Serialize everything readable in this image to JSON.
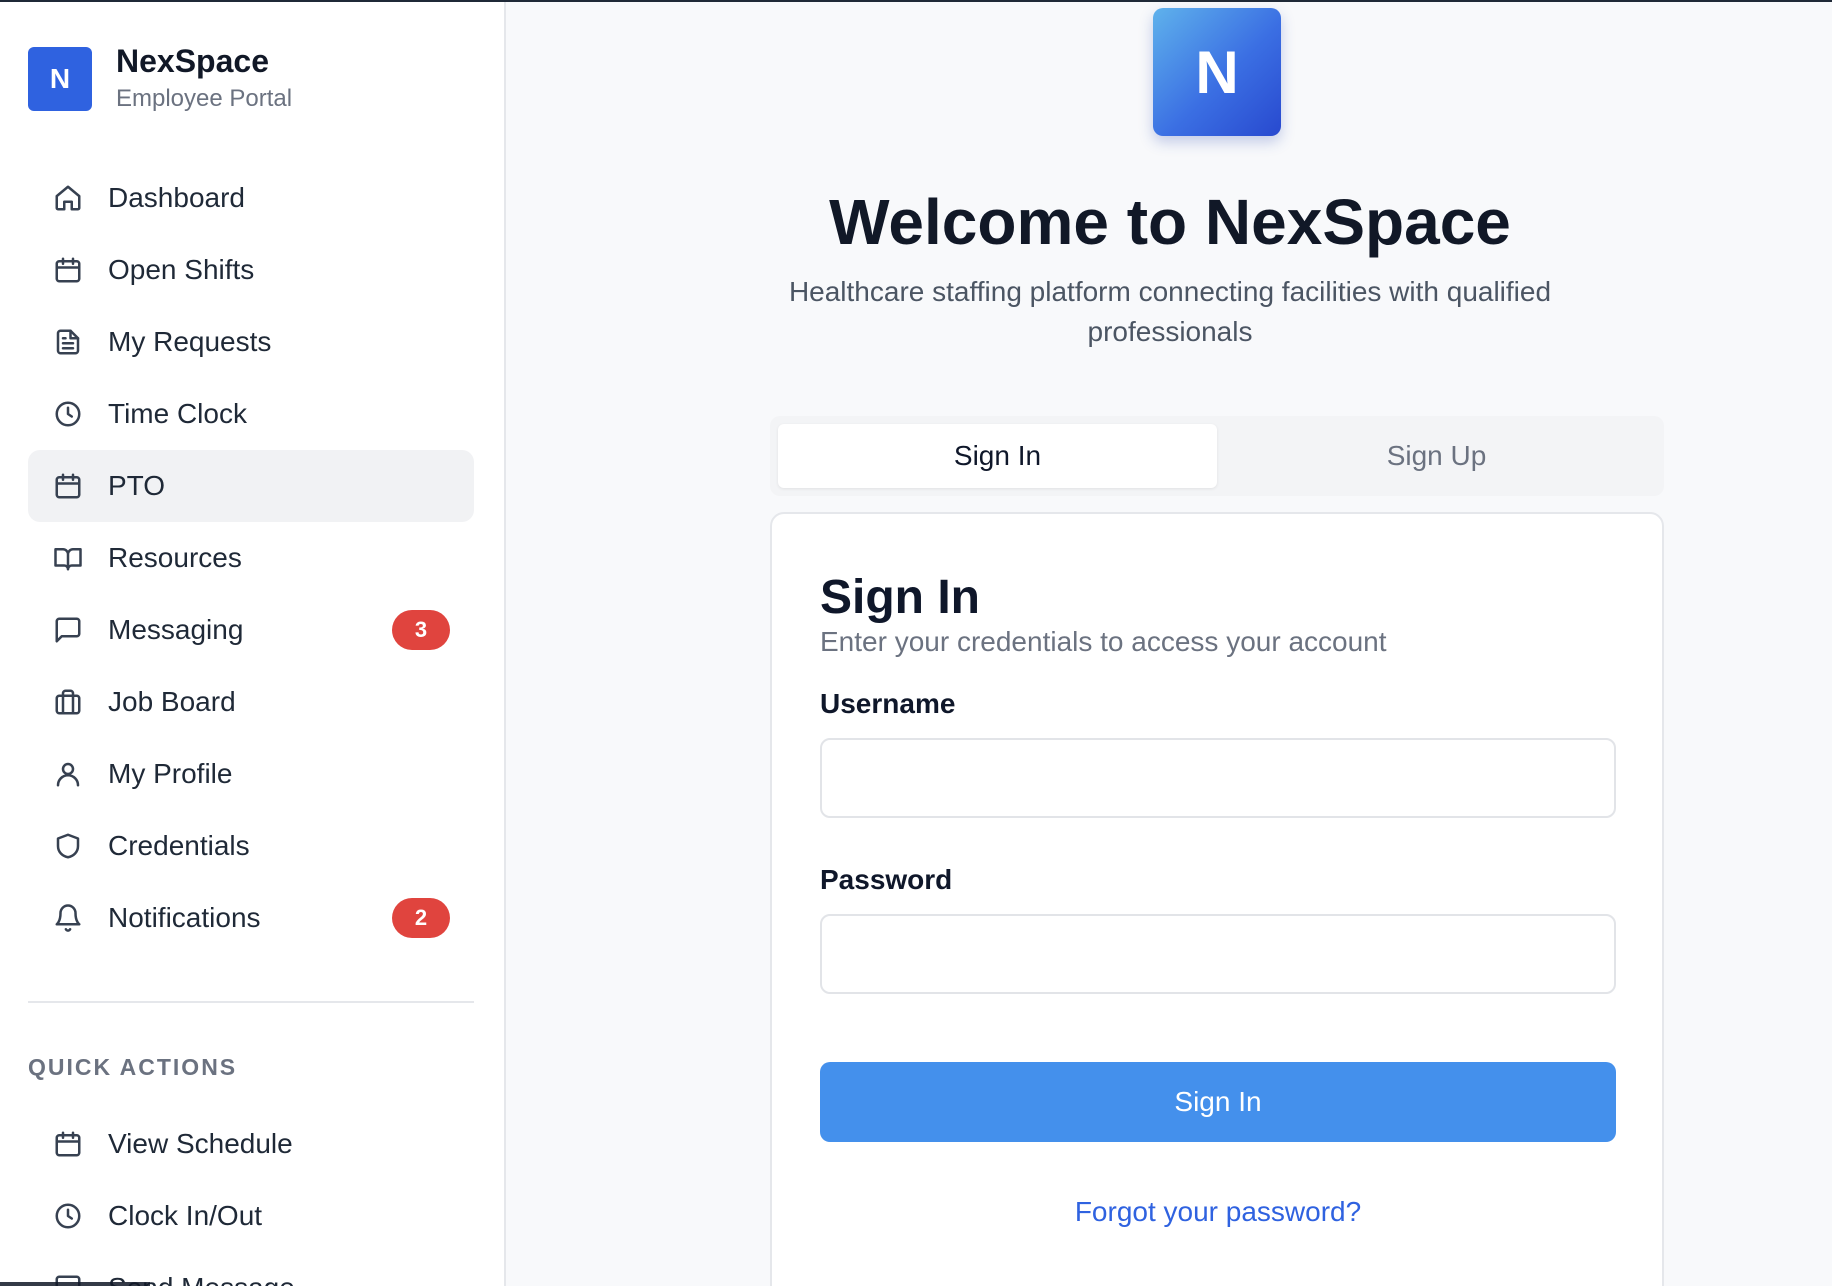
{
  "brand": {
    "logo_letter": "N",
    "name": "NexSpace",
    "subtitle": "Employee Portal"
  },
  "nav": {
    "items": [
      {
        "label": "Dashboard",
        "icon": "home-icon"
      },
      {
        "label": "Open Shifts",
        "icon": "calendar-icon"
      },
      {
        "label": "My Requests",
        "icon": "file-text-icon"
      },
      {
        "label": "Time Clock",
        "icon": "clock-icon"
      },
      {
        "label": "PTO",
        "icon": "calendar-icon",
        "active": true
      },
      {
        "label": "Resources",
        "icon": "book-open-icon"
      },
      {
        "label": "Messaging",
        "icon": "message-square-icon",
        "badge": "3"
      },
      {
        "label": "Job Board",
        "icon": "briefcase-icon"
      },
      {
        "label": "My Profile",
        "icon": "user-icon"
      },
      {
        "label": "Credentials",
        "icon": "shield-icon"
      },
      {
        "label": "Notifications",
        "icon": "bell-icon",
        "badge": "2"
      }
    ]
  },
  "quick_actions": {
    "title": "QUICK ACTIONS",
    "items": [
      {
        "label": "View Schedule",
        "icon": "calendar-icon"
      },
      {
        "label": "Clock In/Out",
        "icon": "clock-icon"
      },
      {
        "label": "Send Message",
        "icon": "message-square-icon"
      }
    ]
  },
  "main": {
    "logo_letter": "N",
    "welcome": "Welcome to NexSpace",
    "tagline": "Healthcare staffing platform connecting facilities with qualified professionals",
    "tabs": [
      {
        "label": "Sign In",
        "active": true
      },
      {
        "label": "Sign Up",
        "active": false
      }
    ],
    "card": {
      "title": "Sign In",
      "subtitle": "Enter your credentials to access your account",
      "username_label": "Username",
      "username_value": "",
      "password_label": "Password",
      "password_value": "",
      "submit_label": "Sign In",
      "forgot_label": "Forgot your password?"
    }
  },
  "colors": {
    "brand": "#2f62e0",
    "button": "#4490ec",
    "badge": "#e0443e",
    "link": "#2f62e0"
  }
}
